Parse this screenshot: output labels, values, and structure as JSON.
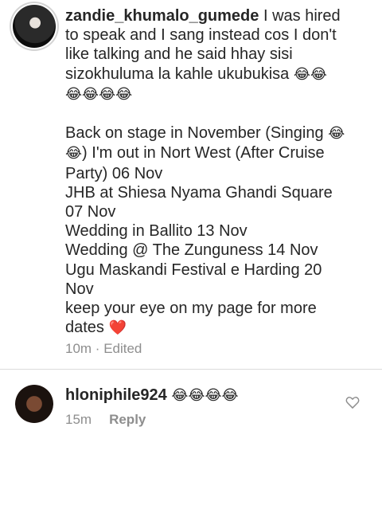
{
  "comment": {
    "username": "zandie_khumalo_gumede",
    "text_line_1": " I was hired to speak and I sang instead cos I don't like talking and he said hhay sisi sizokhuluma la kahle ukubukisa ",
    "emoji_1": "😂😂",
    "emoji_2": "😂😂😂😂",
    "para_2_a": "Back on stage in November (Singing ",
    "emoji_3": "😂😂",
    "para_2_b": ") I'm out in Nort West (After Cruise Party) 06 Nov",
    "line_jhb": "JHB at Shiesa Nyama Ghandi Square 07 Nov",
    "line_ballito": "Wedding  in Ballito 13 Nov",
    "line_zunguness": "Wedding @ The Zunguness 14 Nov",
    "line_ugu": "Ugu Maskandi Festival e Harding 20 Nov",
    "line_keep": "keep your eye on my page for more dates ",
    "heart_emoji": "❤️",
    "time": "10m",
    "separator": " · ",
    "edited": "Edited"
  },
  "reply": {
    "username": "hloniphile924",
    "emoji": "😂😂😂😂",
    "time": "15m",
    "reply_label": "Reply"
  },
  "icons": {
    "like": "heart-outline-icon"
  }
}
